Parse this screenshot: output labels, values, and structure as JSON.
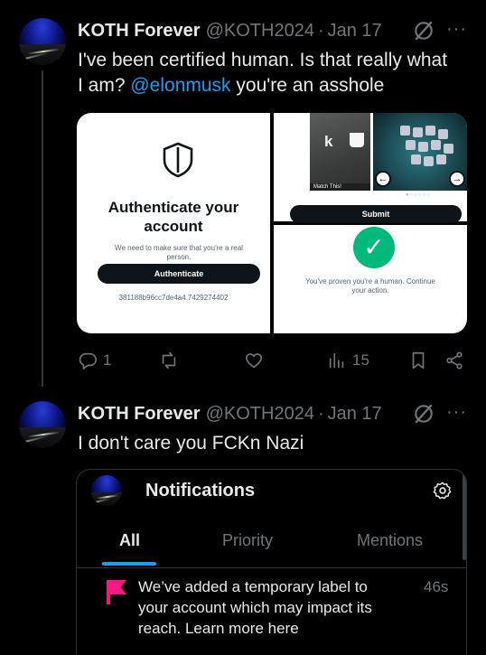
{
  "tweet1": {
    "author_name": "KOTH Forever",
    "handle": "@KOTH2024",
    "separator": "·",
    "date": "Jan 17",
    "more": "···",
    "text_before": "I've been certified human. Is that really what I am? ",
    "mention": "@elonmusk",
    "text_after": " you're an asshole",
    "media": {
      "auth_title": "Authenticate your account",
      "auth_desc": "We need to make sure that you're a real person.",
      "auth_button": "Authenticate",
      "auth_code": "381188b96cc7de4a4.7429274402",
      "captcha_glyph": "k",
      "captcha_label": "Match This!",
      "captcha_submit": "Submit",
      "captcha_dots": "●○○○○○",
      "verified_check": "✓",
      "verified_msg": "You've proven you're a human. Continue your action."
    },
    "actions": {
      "replies": "1",
      "views": "15"
    }
  },
  "tweet2": {
    "author_name": "KOTH Forever",
    "handle": "@KOTH2024",
    "separator": "·",
    "date": "Jan 17",
    "more": "···",
    "text": "I don't care you FCKn Nazi",
    "notification_card": {
      "title": "Notifications",
      "tabs": [
        "All",
        "Priority",
        "Mentions"
      ],
      "active_tab": "All",
      "message": "We’ve added a temporary label to your account which may impact its reach. Learn more here",
      "time": "46s"
    }
  },
  "colors": {
    "background": "#000000",
    "text": "#e7e9ea",
    "muted": "#71767b",
    "link": "#1d9bf0",
    "verified_green": "#00ba7c",
    "flag_pink": "#f91880"
  }
}
